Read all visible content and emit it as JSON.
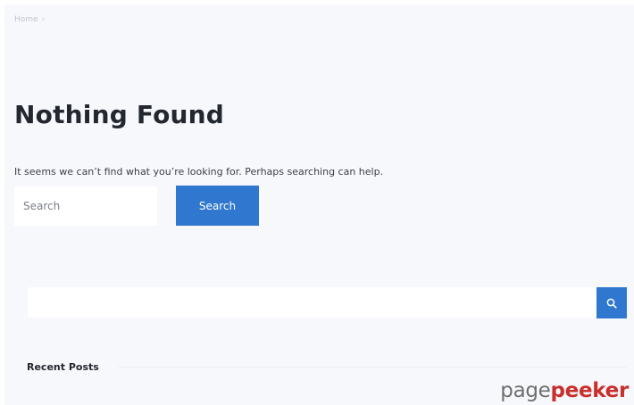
{
  "breadcrumb": {
    "home_label": "Home",
    "separator": "›"
  },
  "main": {
    "title": "Nothing Found",
    "message": "It seems we can’t find what you’re looking for. Perhaps searching can help.",
    "search": {
      "placeholder": "Search",
      "value": "",
      "button_label": "Search"
    }
  },
  "sidebar": {
    "search": {
      "value": "",
      "button_icon": "search-icon"
    },
    "recent_posts_heading": "Recent Posts"
  },
  "watermark": {
    "part1": "page",
    "part2": "peeker"
  },
  "colors": {
    "accent": "#3077d0",
    "background": "#f7f8fc",
    "watermark_accent": "#c9302c"
  }
}
